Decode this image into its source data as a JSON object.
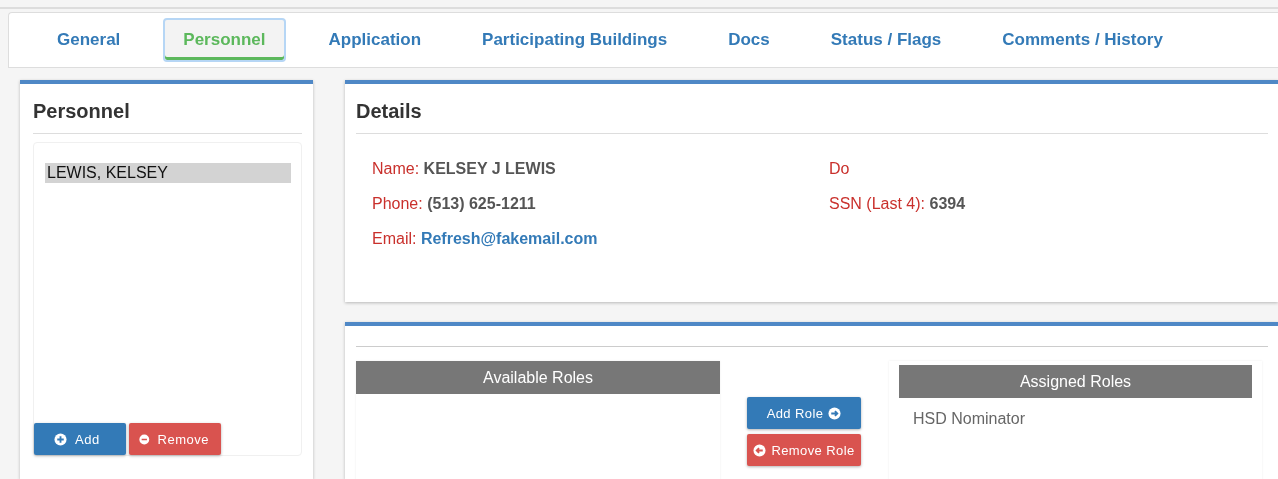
{
  "tabs": [
    {
      "label": "General",
      "selected": false
    },
    {
      "label": "Personnel",
      "selected": true
    },
    {
      "label": "Application",
      "selected": false
    },
    {
      "label": "Participating Buildings",
      "selected": false
    },
    {
      "label": "Docs",
      "selected": false
    },
    {
      "label": "Status / Flags",
      "selected": false
    },
    {
      "label": "Comments / History",
      "selected": false
    }
  ],
  "personnel": {
    "title": "Personnel",
    "items": [
      {
        "label": "LEWIS, KELSEY",
        "selected": true
      }
    ],
    "buttons": [
      {
        "label": "Add",
        "kind": "add"
      },
      {
        "label": "Remove",
        "kind": "remove"
      }
    ]
  },
  "details": {
    "title": "Details",
    "fields": [
      {
        "label": "Name:",
        "value": "KELSEY J LEWIS",
        "kind": "text"
      },
      {
        "label": "Do"
      },
      {
        "label": "Phone:",
        "value": "(513) 625-1211",
        "kind": "text"
      },
      {
        "label": "SSN (Last 4):",
        "value": "6394",
        "kind": "text"
      },
      {
        "label": "Email:",
        "value": "Refresh@fakemail.com",
        "kind": "link"
      }
    ]
  },
  "roles": {
    "available": {
      "title": "Available Roles"
    },
    "buttons": [
      {
        "label": "Add Role",
        "kind": "add"
      },
      {
        "label": "Remove Role",
        "kind": "remove"
      }
    ],
    "assigned": {
      "title": "Assigned Roles",
      "items": [
        "HSD Nominator"
      ]
    }
  }
}
